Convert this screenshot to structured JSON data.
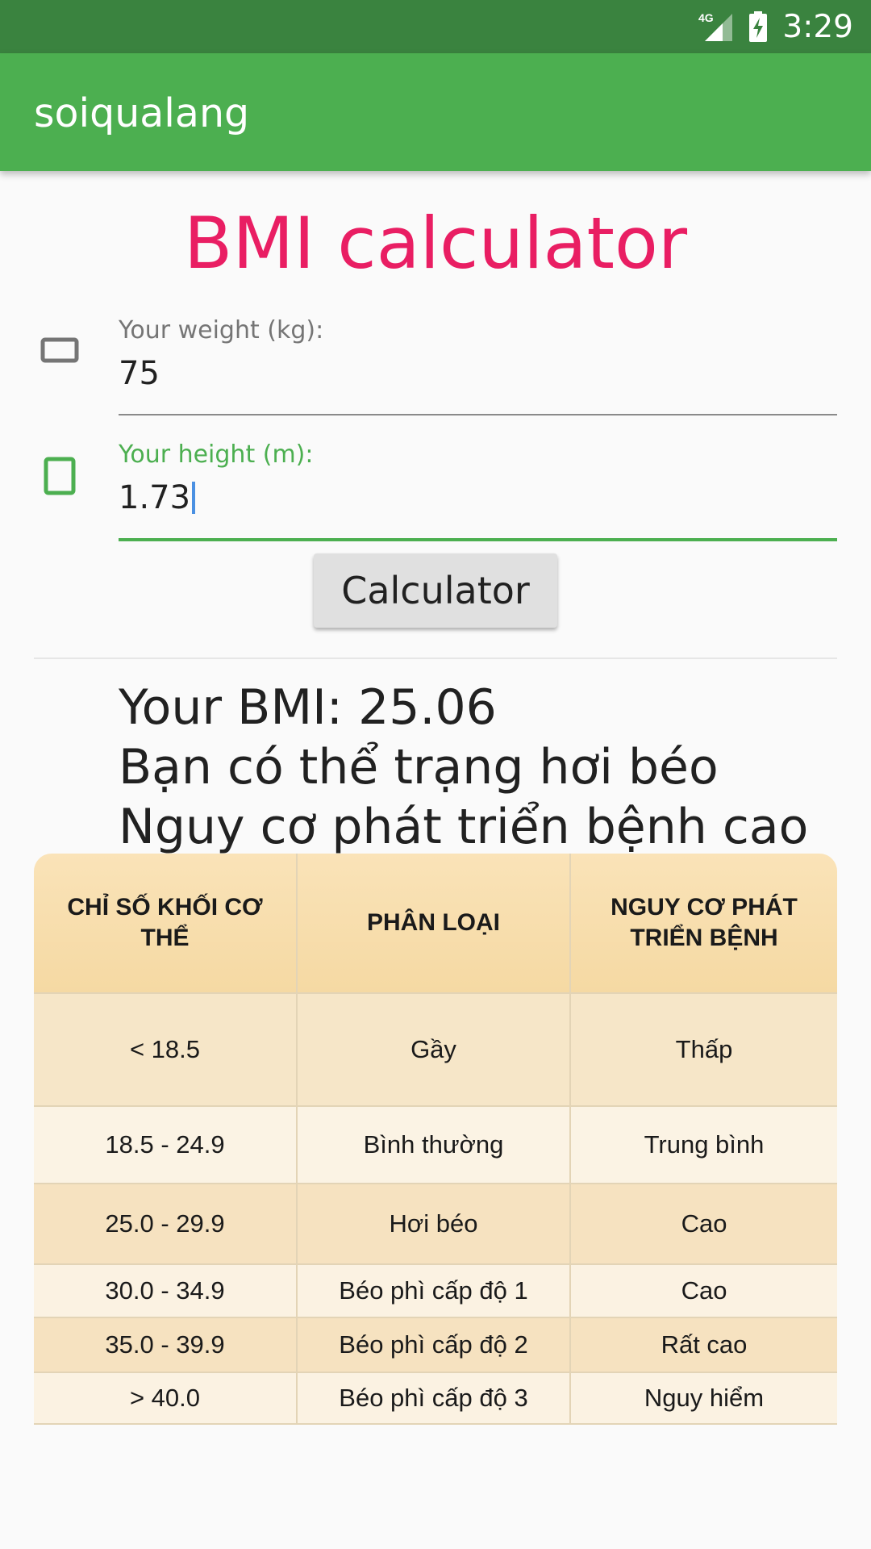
{
  "status_bar": {
    "network": "4G",
    "time": "3:29"
  },
  "app_bar": {
    "title": "soiqualang"
  },
  "page": {
    "title": "BMI calculator"
  },
  "form": {
    "weight": {
      "label": "Your weight (kg):",
      "value": "75"
    },
    "height": {
      "label": "Your height (m):",
      "value": "1.73"
    },
    "calc_button": "Calculator"
  },
  "result": {
    "bmi_line": "Your BMI: 25.06",
    "status_line": "Bạn có thể trạng hơi béo",
    "risk_line": "Nguy cơ phát triển bệnh cao"
  },
  "table": {
    "headers": [
      "CHỈ SỐ KHỐI CƠ THỂ",
      "PHÂN LOẠI",
      "NGUY CƠ PHÁT TRIỂN BỆNH"
    ],
    "rows": [
      [
        "< 18.5",
        "Gầy",
        "Thấp"
      ],
      [
        "18.5 - 24.9",
        "Bình thường",
        "Trung bình"
      ],
      [
        "25.0 - 29.9",
        "Hơi béo",
        "Cao"
      ],
      [
        "30.0 - 34.9",
        "Béo phì cấp độ 1",
        "Cao"
      ],
      [
        "35.0 - 39.9",
        "Béo phì cấp độ 2",
        "Rất cao"
      ],
      [
        "> 40.0",
        "Béo phì cấp độ 3",
        "Nguy hiểm"
      ]
    ]
  },
  "colors": {
    "status_bar": "#3a833f",
    "app_bar": "#4caf50",
    "title_accent": "#e91e63",
    "focus_green": "#4caf50",
    "table_header": "#f7dca8",
    "table_row_dark": "#f6e4c4",
    "table_row_light": "#fbf2e2"
  },
  "icons": {
    "weight_field": "rectangle-outline-icon",
    "height_field": "square-outline-icon",
    "signal": "signal-icon",
    "battery": "battery-charging-icon"
  }
}
